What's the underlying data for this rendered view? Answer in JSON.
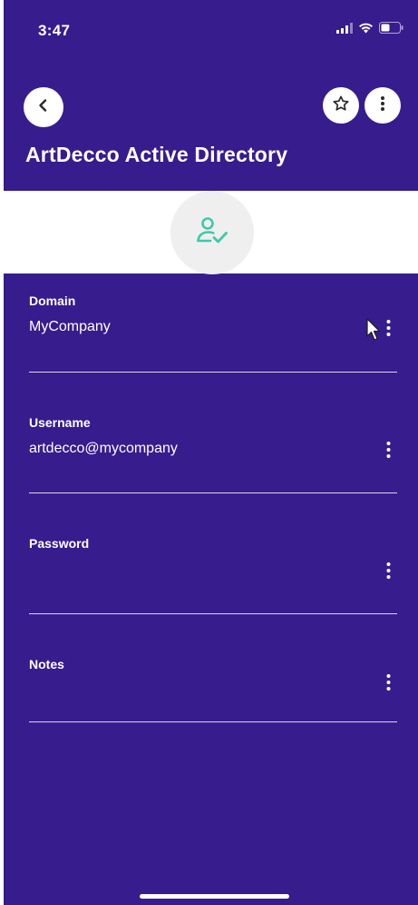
{
  "status_bar": {
    "time": "3:47",
    "icons": [
      "cellular-signal-icon",
      "wifi-icon",
      "battery-icon"
    ]
  },
  "header": {
    "title": "ArtDecco Active Directory",
    "back_icon": "chevron-left-icon",
    "favorite_icon": "star-outline-icon",
    "more_icon": "more-vertical-icon"
  },
  "record_type": {
    "icon": "user-check-icon",
    "icon_color": "#3ec9a7"
  },
  "fields": [
    {
      "label": "Domain",
      "value": "MyCompany"
    },
    {
      "label": "Username",
      "value": "artdecco@mycompany"
    },
    {
      "label": "Password",
      "value": ""
    },
    {
      "label": "Notes",
      "value": ""
    }
  ],
  "colors": {
    "background": "#371c8e",
    "band": "#ffffff",
    "accent": "#3ec9a7"
  }
}
